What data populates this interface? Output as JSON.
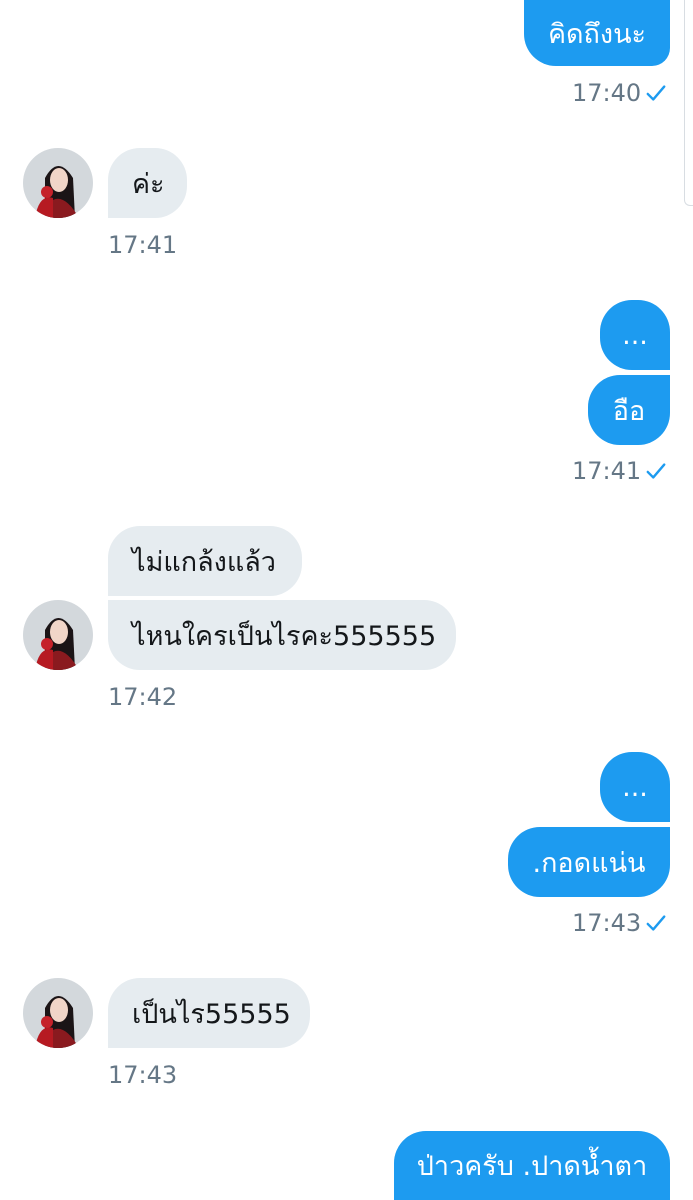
{
  "conversation": {
    "messages": [
      {
        "text": "คิดถึงนะ",
        "from": "me"
      },
      {
        "text": "ค่ะ",
        "from": "them"
      },
      {
        "text": "...",
        "from": "me"
      },
      {
        "text": "อือ",
        "from": "me"
      },
      {
        "text": "ไม่แกล้งแล้ว",
        "from": "them"
      },
      {
        "text": "ไหนใครเป็นไรคะ555555",
        "from": "them"
      },
      {
        "text": "...",
        "from": "me"
      },
      {
        "text": ".กอดแน่น",
        "from": "me"
      },
      {
        "text": "เป็นไร55555",
        "from": "them"
      },
      {
        "text": "ป่าวครับ .ปาดน้ำตา",
        "from": "me"
      }
    ],
    "timestamps": [
      "17:40",
      "17:41",
      "17:41",
      "17:42",
      "17:43",
      "17:43"
    ]
  },
  "colors": {
    "sent_bubble": "#1d9bf0",
    "received_bubble": "#e6ecf0",
    "timestamp": "#657786",
    "read_check": "#1d9bf0"
  },
  "icons": {
    "read_receipt": "checkmark-icon",
    "avatar": "avatar"
  }
}
